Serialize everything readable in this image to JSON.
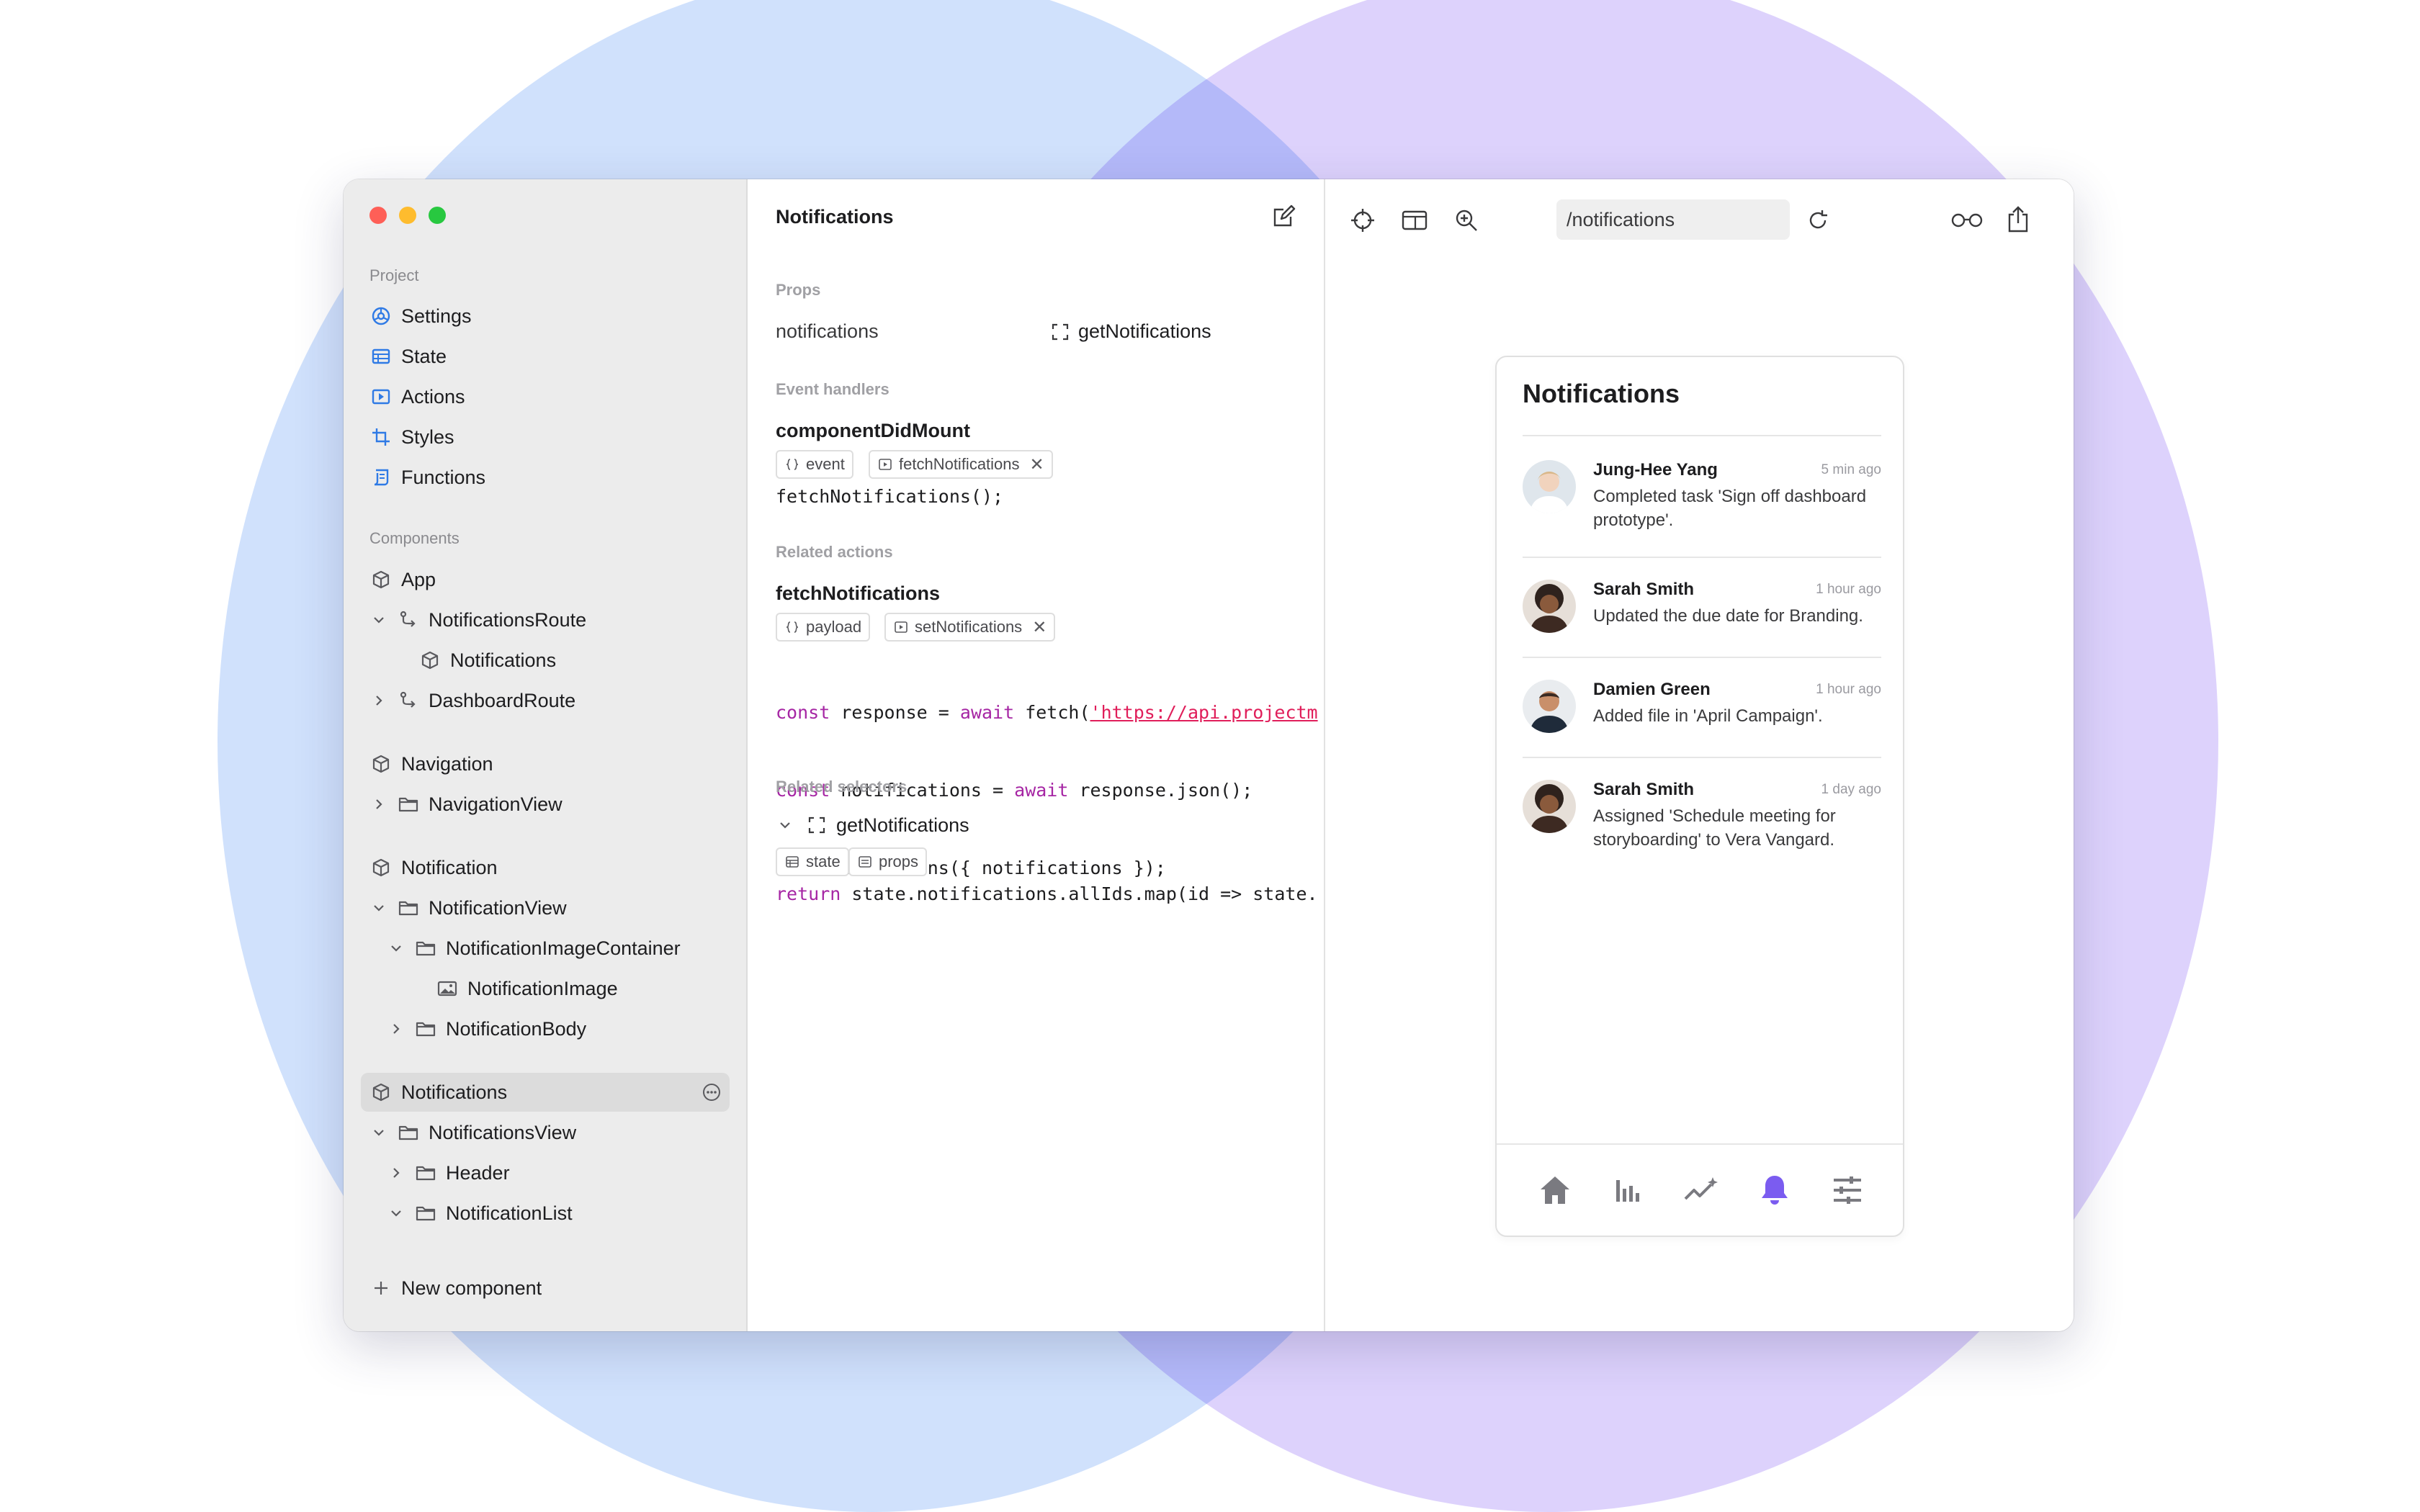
{
  "window": {
    "traffic_lights": {
      "close": "#fe5f57",
      "minimize": "#febc2e",
      "zoom": "#28c840"
    }
  },
  "sidebar": {
    "project_heading": "Project",
    "project_items": [
      {
        "label": "Settings",
        "icon": "settings-icon"
      },
      {
        "label": "State",
        "icon": "table-icon"
      },
      {
        "label": "Actions",
        "icon": "play-icon"
      },
      {
        "label": "Styles",
        "icon": "crop-icon"
      },
      {
        "label": "Functions",
        "icon": "script-icon"
      }
    ],
    "components_heading": "Components",
    "tree": {
      "app": "App",
      "notifications_route": "NotificationsRoute",
      "notifications_child": "Notifications",
      "dashboard_route": "DashboardRoute",
      "navigation": "Navigation",
      "navigation_view": "NavigationView",
      "notification": "Notification",
      "notification_view": "NotificationView",
      "notification_image_container": "NotificationImageContainer",
      "notification_image": "NotificationImage",
      "notification_body": "NotificationBody",
      "notifications_selected": "Notifications",
      "notifications_view": "NotificationsView",
      "header": "Header",
      "notification_list": "NotificationList"
    },
    "new_component": "New component"
  },
  "middle": {
    "title": "Notifications",
    "props_heading": "Props",
    "prop_name": "notifications",
    "prop_value": "getNotifications",
    "event_handlers_heading": "Event handlers",
    "handler_name": "componentDidMount",
    "handler_chips": {
      "event": "event",
      "action": "fetchNotifications"
    },
    "handler_code": "fetchNotifications();",
    "related_actions_heading": "Related actions",
    "action_name": "fetchNotifications",
    "action_chips": {
      "payload": "payload",
      "action": "setNotifications"
    },
    "action_code": {
      "line1_kw1": "const",
      "line1_a": " response = ",
      "line1_kw2": "await",
      "line1_b": " fetch(",
      "line1_str": "'https://api.projectm",
      "line2_kw1": "const",
      "line2_a": " notifications = ",
      "line2_kw2": "await",
      "line2_b": " response.json();",
      "line3": "setNotifications({ notifications });"
    },
    "related_selectors_heading": "Related selectors",
    "selector_name": "getNotifications",
    "selector_chips": {
      "state": "state",
      "props": "props"
    },
    "selector_code": {
      "kw": "return",
      "rest": " state.notifications.allIds.map(id => state."
    }
  },
  "preview": {
    "url": "/notifications",
    "phone_title": "Notifications",
    "notifications": [
      {
        "name": "Jung-Hee Yang",
        "time": "5 min ago",
        "message": "Completed task 'Sign off dashboard prototype'."
      },
      {
        "name": "Sarah Smith",
        "time": "1 hour ago",
        "message": "Updated the due date for Branding."
      },
      {
        "name": "Damien Green",
        "time": "1 hour ago",
        "message": "Added file in 'April Campaign'."
      },
      {
        "name": "Sarah Smith",
        "time": "1 day ago",
        "message": "Assigned 'Schedule meeting for storyboarding' to Vera Vangard."
      }
    ],
    "tabs": [
      {
        "icon": "home-icon",
        "active": false
      },
      {
        "icon": "bar-chart-icon",
        "active": false
      },
      {
        "icon": "trend-sparkle-icon",
        "active": false
      },
      {
        "icon": "bell-icon",
        "active": true
      },
      {
        "icon": "sliders-icon",
        "active": false
      }
    ],
    "accent_color": "#7b5cf0"
  }
}
